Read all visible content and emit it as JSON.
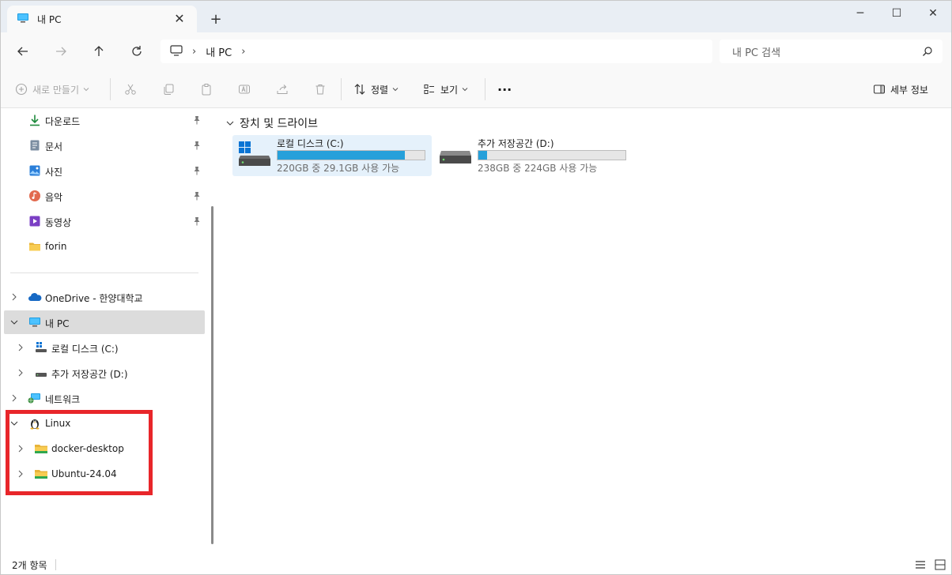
{
  "window": {
    "tab_title": "내 PC",
    "close_tab_glyph": "✕",
    "new_tab_glyph": "+",
    "minimize_glyph": "─",
    "maximize_glyph": "☐",
    "close_glyph": "✕"
  },
  "address_bar": {
    "crumb": "내 PC",
    "separator": "›",
    "search_placeholder": "내 PC 검색"
  },
  "command_bar": {
    "new_label": "새로 만들기",
    "sort_label": "정렬",
    "view_label": "보기",
    "more_glyph": "···",
    "details_label": "세부 정보"
  },
  "sidebar": {
    "quick_access": [
      {
        "label": "다운로드",
        "icon": "download-icon",
        "pinned": true
      },
      {
        "label": "문서",
        "icon": "document-icon",
        "pinned": true
      },
      {
        "label": "사진",
        "icon": "pictures-icon",
        "pinned": true
      },
      {
        "label": "음악",
        "icon": "music-icon",
        "pinned": true
      },
      {
        "label": "동영상",
        "icon": "video-icon",
        "pinned": true
      },
      {
        "label": "forin",
        "icon": "folder-icon",
        "pinned": false
      }
    ],
    "tree": [
      {
        "label": "OneDrive - 한양대학교",
        "icon": "onedrive-icon"
      },
      {
        "label": "내 PC",
        "icon": "pc-icon",
        "selected": true
      },
      {
        "label": "로컬 디스크 (C:)",
        "icon": "windows-drive-icon"
      },
      {
        "label": "추가 저장공간 (D:)",
        "icon": "drive-icon"
      },
      {
        "label": "네트워크",
        "icon": "network-icon"
      },
      {
        "label": "Linux",
        "icon": "linux-icon"
      },
      {
        "label": "docker-desktop",
        "icon": "linux-folder-icon"
      },
      {
        "label": "Ubuntu-24.04",
        "icon": "linux-folder-icon"
      }
    ]
  },
  "content": {
    "group_title": "장치 및 드라이브",
    "drives": [
      {
        "name": "로컬 디스크 (C:)",
        "info": "220GB 중 29.1GB 사용 가능",
        "used_fraction": 0.868,
        "selected": true
      },
      {
        "name": "추가 저장공간 (D:)",
        "info": "238GB 중 224GB 사용 가능",
        "used_fraction": 0.059,
        "selected": false
      }
    ]
  },
  "status_bar": {
    "item_count": "2개 항목"
  },
  "colors": {
    "accent": "#26a0da",
    "highlight_border": "#e8262a",
    "selected_bg": "#dcdcdc"
  }
}
